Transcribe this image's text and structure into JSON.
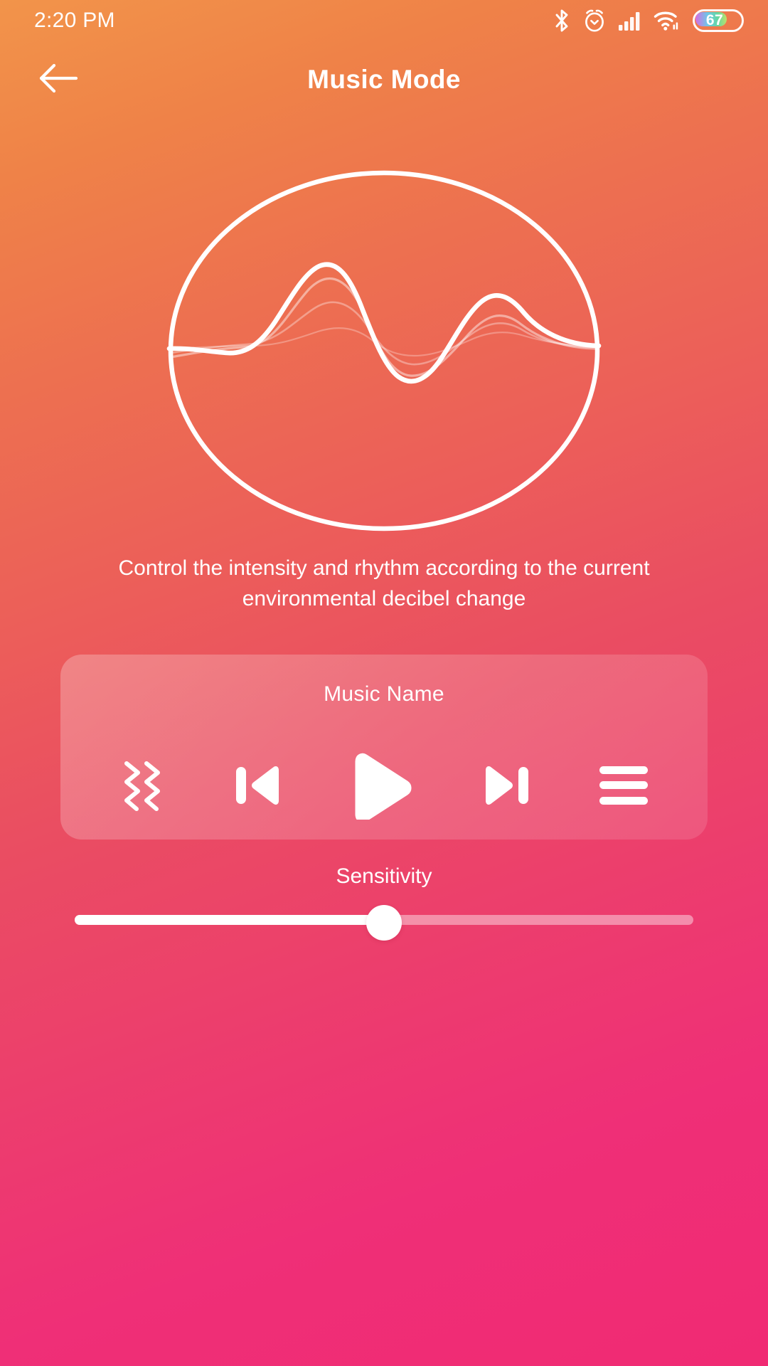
{
  "statusbar": {
    "time": "2:20 PM",
    "icons": [
      "bluetooth-icon",
      "alarm-icon",
      "cellular-signal-icon",
      "wifi-icon"
    ],
    "battery_percent": "67"
  },
  "header": {
    "back_icon": "arrow-left-icon",
    "title": "Music Mode"
  },
  "hero": {
    "icon": "audio-waveform-circle-illustration"
  },
  "description": {
    "text": "Control the intensity and rhythm according to the current environmental decibel change"
  },
  "player": {
    "music_name": "Music Name",
    "controls": [
      {
        "name": "vibrate-button",
        "icon": "vibration-icon"
      },
      {
        "name": "previous-track-button",
        "icon": "skip-previous-icon"
      },
      {
        "name": "play-button",
        "icon": "play-icon"
      },
      {
        "name": "next-track-button",
        "icon": "skip-next-icon"
      },
      {
        "name": "playlist-button",
        "icon": "list-menu-icon"
      }
    ]
  },
  "sensitivity": {
    "label": "Sensitivity",
    "value_percent": 50,
    "min": 0,
    "max": 100
  },
  "colors": {
    "gradient_top": "#f2944a",
    "gradient_mid": "#ec5f59",
    "gradient_bottom": "#f02a73",
    "foreground": "#ffffff",
    "card_overlay": "rgba(255,255,255,0.22)",
    "track_inactive": "rgba(255,255,255,0.42)"
  }
}
